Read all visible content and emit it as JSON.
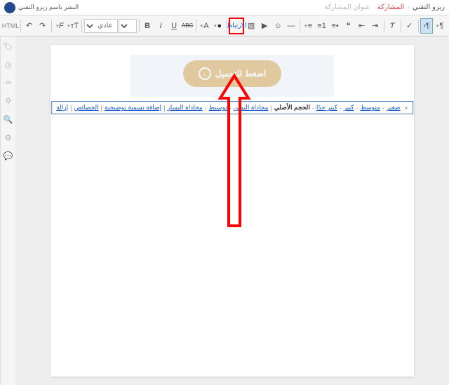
{
  "header": {
    "blog_name": "زيزو التقني",
    "share": "المشاركة",
    "title_ph": "عنوان المشاركة",
    "publish_prefix": "النشر باسم",
    "author": "زيزو التقني"
  },
  "toolbar": {
    "html": "HTML",
    "undo": "↶",
    "redo": "↷",
    "font": "F",
    "fontsize": "тT",
    "format": "عادي",
    "bold": "B",
    "italic": "I",
    "underline": "U",
    "strike": "ABC",
    "color": "A",
    "bg": "●",
    "link": "الارتباط",
    "image": "▧",
    "video": "▶",
    "smile": "☺",
    "break": "—",
    "alignr": "≡",
    "alignc": "≡",
    "alignl": "≡",
    "ol": "1≡",
    "ul": "•≡",
    "quote": "❝",
    "indent": "⇥",
    "outdent": "⇤",
    "clear": "Ƭ",
    "spell": "✓",
    "ltr": "¶",
    "rtl": "¶"
  },
  "editor": {
    "download_label": "اضغط للتحميل"
  },
  "img_opts": {
    "small": "صغير",
    "medium": "متوسط",
    "large": "كبير",
    "xlarge": "كبير جدًا",
    "original": "الحجم الأصلي",
    "alignr": "محاذاة اليمين",
    "alignc": "توسيط",
    "alignl": "محاذاة اليسار",
    "caption": "إضافة تسمية توضيحية",
    "props": "الخصائص",
    "remove": "إزالة"
  }
}
